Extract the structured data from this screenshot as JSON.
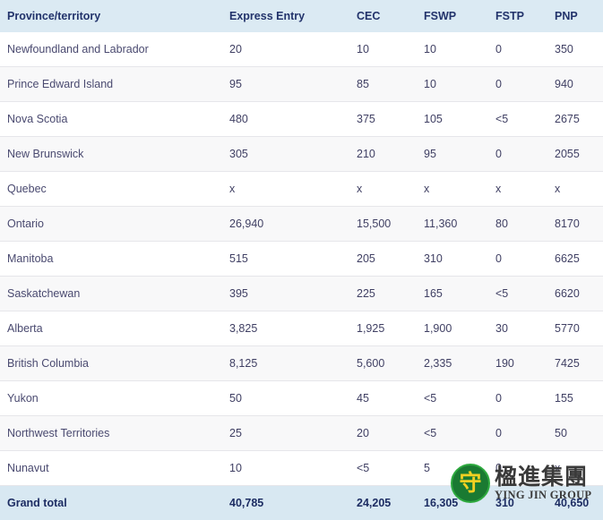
{
  "table": {
    "columns": [
      {
        "key": "province",
        "label": "Province/territory"
      },
      {
        "key": "express_entry",
        "label": "Express Entry"
      },
      {
        "key": "cec",
        "label": "CEC"
      },
      {
        "key": "fswp",
        "label": "FSWP"
      },
      {
        "key": "fstp",
        "label": "FSTP"
      },
      {
        "key": "pnp",
        "label": "PNP"
      }
    ],
    "rows": [
      {
        "province": "Newfoundland and Labrador",
        "express_entry": "20",
        "cec": "10",
        "fswp": "10",
        "fstp": "0",
        "pnp": "350"
      },
      {
        "province": "Prince Edward Island",
        "express_entry": "95",
        "cec": "85",
        "fswp": "10",
        "fstp": "0",
        "pnp": "940"
      },
      {
        "province": "Nova Scotia",
        "express_entry": "480",
        "cec": "375",
        "fswp": "105",
        "fstp": "<5",
        "pnp": "2675"
      },
      {
        "province": "New Brunswick",
        "express_entry": "305",
        "cec": "210",
        "fswp": "95",
        "fstp": "0",
        "pnp": "2055"
      },
      {
        "province": "Quebec",
        "express_entry": "x",
        "cec": "x",
        "fswp": "x",
        "fstp": "x",
        "pnp": "x"
      },
      {
        "province": "Ontario",
        "express_entry": "26,940",
        "cec": "15,500",
        "fswp": "11,360",
        "fstp": "80",
        "pnp": "8170"
      },
      {
        "province": "Manitoba",
        "express_entry": "515",
        "cec": "205",
        "fswp": "310",
        "fstp": "0",
        "pnp": "6625"
      },
      {
        "province": "Saskatchewan",
        "express_entry": "395",
        "cec": "225",
        "fswp": "165",
        "fstp": "<5",
        "pnp": "6620"
      },
      {
        "province": "Alberta",
        "express_entry": "3,825",
        "cec": "1,925",
        "fswp": "1,900",
        "fstp": "30",
        "pnp": "5770"
      },
      {
        "province": "British Columbia",
        "express_entry": "8,125",
        "cec": "5,600",
        "fswp": "2,335",
        "fstp": "190",
        "pnp": "7425"
      },
      {
        "province": "Yukon",
        "express_entry": "50",
        "cec": "45",
        "fswp": "<5",
        "fstp": "0",
        "pnp": "155"
      },
      {
        "province": "Northwest Territories",
        "express_entry": "25",
        "cec": "20",
        "fswp": "<5",
        "fstp": "0",
        "pnp": "50"
      },
      {
        "province": "Nunavut",
        "express_entry": "10",
        "cec": "<5",
        "fswp": "5",
        "fstp": "0",
        "pnp": "x"
      }
    ],
    "total_row": {
      "province": "Grand total",
      "express_entry": "40,785",
      "cec": "24,205",
      "fswp": "16,305",
      "fstp": "310",
      "pnp": "40,650"
    }
  },
  "watermark": {
    "logo_glyph": "守",
    "chinese_name": "楹進集團",
    "english_name": "YING JIN GROUP"
  },
  "colors": {
    "header_background": "#dbeaf3",
    "header_text": "#22336b",
    "total_background": "#d8e8f2",
    "total_text": "#1d2d63",
    "body_text": "#3f3f63",
    "stripe_background": "#f8f8f9",
    "row_divider": "#e6e6ea",
    "watermark_green": "#1a7a32",
    "watermark_gold": "#f2d022"
  }
}
